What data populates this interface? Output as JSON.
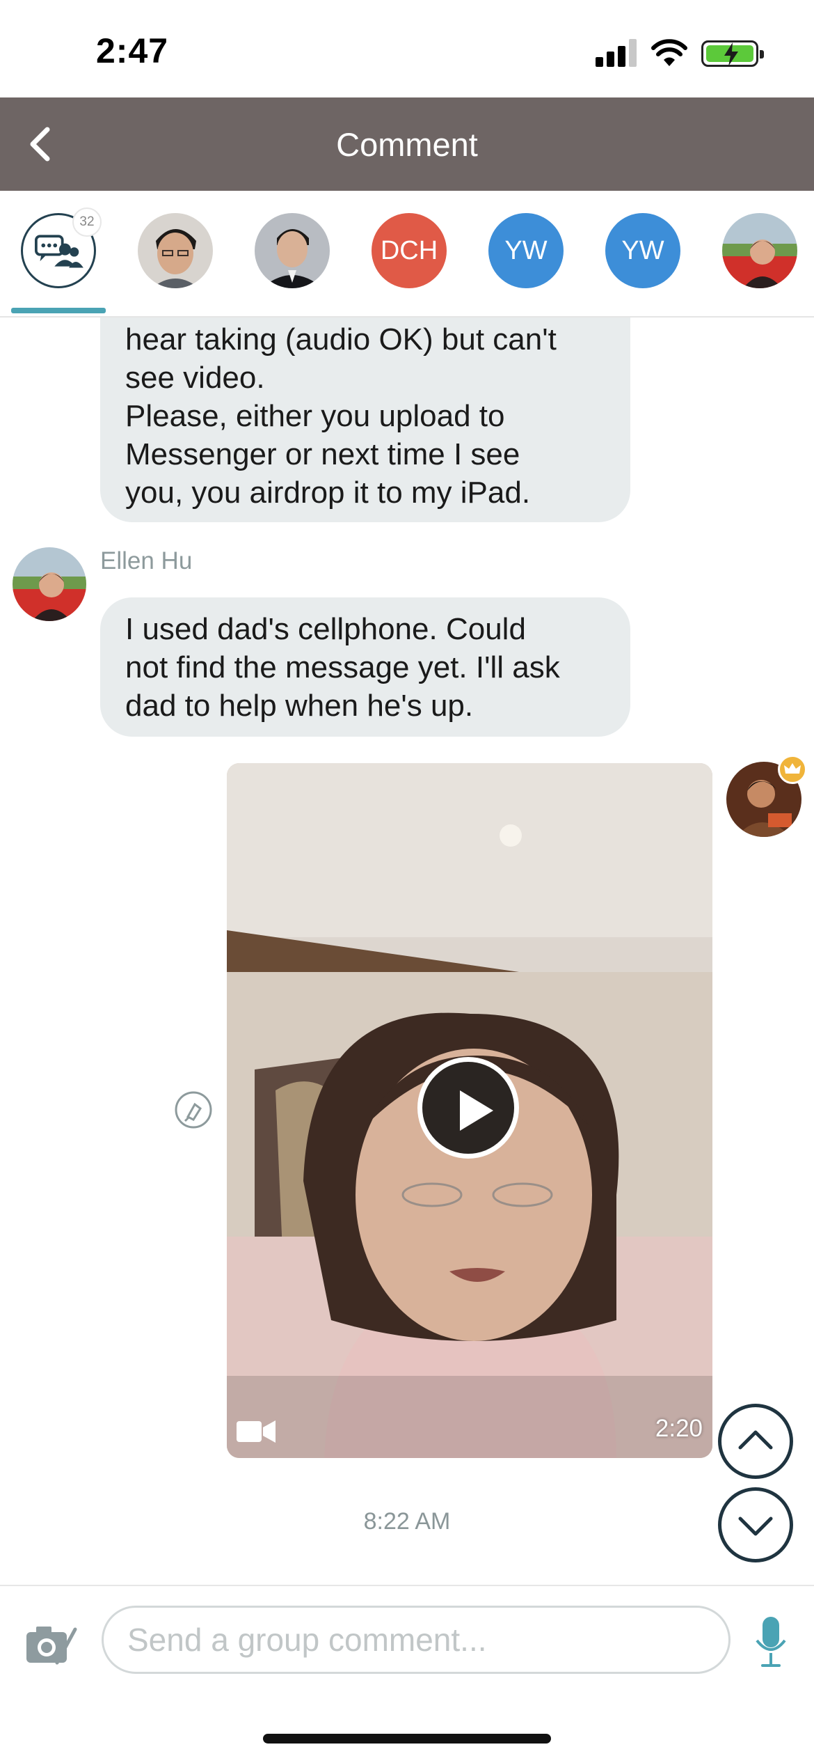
{
  "status_bar": {
    "time": "2:47"
  },
  "header": {
    "title": "Comment"
  },
  "participants": {
    "group_count": "32",
    "avatars": [
      {
        "kind": "photo",
        "name": "man-glasses"
      },
      {
        "kind": "photo",
        "name": "man-suit"
      },
      {
        "kind": "initials",
        "text": "DCH",
        "color": "#e05a47"
      },
      {
        "kind": "initials",
        "text": "YW",
        "color": "#3d8ed8"
      },
      {
        "kind": "initials",
        "text": "YW",
        "color": "#3d8ed8"
      },
      {
        "kind": "photo",
        "name": "woman-flowers"
      }
    ]
  },
  "messages": [
    {
      "lines": [
        "hear taking (audio OK) but can't",
        "see video.",
        "Please, either you upload to",
        "Messenger or next time I see",
        "you, you airdrop it to my iPad."
      ]
    },
    {
      "sender": "Ellen Hu",
      "lines": [
        "I used dad's cellphone. Could",
        "not find the message yet. I'll ask",
        "dad to help when he's up."
      ]
    }
  ],
  "video": {
    "duration": "2:20",
    "time": "8:22 AM"
  },
  "composer": {
    "placeholder": "Send a group comment..."
  },
  "colors": {
    "header": "#6e6564",
    "accent": "#4aa3b4",
    "bubble": "#e8eced"
  }
}
